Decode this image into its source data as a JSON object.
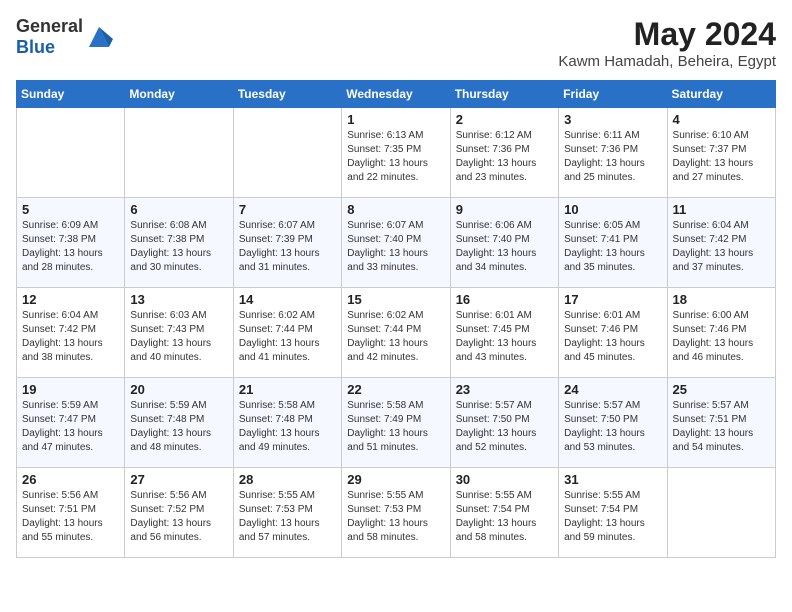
{
  "logo": {
    "general": "General",
    "blue": "Blue"
  },
  "title": "May 2024",
  "location": "Kawm Hamadah, Beheira, Egypt",
  "days_of_week": [
    "Sunday",
    "Monday",
    "Tuesday",
    "Wednesday",
    "Thursday",
    "Friday",
    "Saturday"
  ],
  "weeks": [
    [
      {
        "day": "",
        "sunrise": "",
        "sunset": "",
        "daylight": ""
      },
      {
        "day": "",
        "sunrise": "",
        "sunset": "",
        "daylight": ""
      },
      {
        "day": "",
        "sunrise": "",
        "sunset": "",
        "daylight": ""
      },
      {
        "day": "1",
        "sunrise": "Sunrise: 6:13 AM",
        "sunset": "Sunset: 7:35 PM",
        "daylight": "Daylight: 13 hours and 22 minutes."
      },
      {
        "day": "2",
        "sunrise": "Sunrise: 6:12 AM",
        "sunset": "Sunset: 7:36 PM",
        "daylight": "Daylight: 13 hours and 23 minutes."
      },
      {
        "day": "3",
        "sunrise": "Sunrise: 6:11 AM",
        "sunset": "Sunset: 7:36 PM",
        "daylight": "Daylight: 13 hours and 25 minutes."
      },
      {
        "day": "4",
        "sunrise": "Sunrise: 6:10 AM",
        "sunset": "Sunset: 7:37 PM",
        "daylight": "Daylight: 13 hours and 27 minutes."
      }
    ],
    [
      {
        "day": "5",
        "sunrise": "Sunrise: 6:09 AM",
        "sunset": "Sunset: 7:38 PM",
        "daylight": "Daylight: 13 hours and 28 minutes."
      },
      {
        "day": "6",
        "sunrise": "Sunrise: 6:08 AM",
        "sunset": "Sunset: 7:38 PM",
        "daylight": "Daylight: 13 hours and 30 minutes."
      },
      {
        "day": "7",
        "sunrise": "Sunrise: 6:07 AM",
        "sunset": "Sunset: 7:39 PM",
        "daylight": "Daylight: 13 hours and 31 minutes."
      },
      {
        "day": "8",
        "sunrise": "Sunrise: 6:07 AM",
        "sunset": "Sunset: 7:40 PM",
        "daylight": "Daylight: 13 hours and 33 minutes."
      },
      {
        "day": "9",
        "sunrise": "Sunrise: 6:06 AM",
        "sunset": "Sunset: 7:40 PM",
        "daylight": "Daylight: 13 hours and 34 minutes."
      },
      {
        "day": "10",
        "sunrise": "Sunrise: 6:05 AM",
        "sunset": "Sunset: 7:41 PM",
        "daylight": "Daylight: 13 hours and 35 minutes."
      },
      {
        "day": "11",
        "sunrise": "Sunrise: 6:04 AM",
        "sunset": "Sunset: 7:42 PM",
        "daylight": "Daylight: 13 hours and 37 minutes."
      }
    ],
    [
      {
        "day": "12",
        "sunrise": "Sunrise: 6:04 AM",
        "sunset": "Sunset: 7:42 PM",
        "daylight": "Daylight: 13 hours and 38 minutes."
      },
      {
        "day": "13",
        "sunrise": "Sunrise: 6:03 AM",
        "sunset": "Sunset: 7:43 PM",
        "daylight": "Daylight: 13 hours and 40 minutes."
      },
      {
        "day": "14",
        "sunrise": "Sunrise: 6:02 AM",
        "sunset": "Sunset: 7:44 PM",
        "daylight": "Daylight: 13 hours and 41 minutes."
      },
      {
        "day": "15",
        "sunrise": "Sunrise: 6:02 AM",
        "sunset": "Sunset: 7:44 PM",
        "daylight": "Daylight: 13 hours and 42 minutes."
      },
      {
        "day": "16",
        "sunrise": "Sunrise: 6:01 AM",
        "sunset": "Sunset: 7:45 PM",
        "daylight": "Daylight: 13 hours and 43 minutes."
      },
      {
        "day": "17",
        "sunrise": "Sunrise: 6:01 AM",
        "sunset": "Sunset: 7:46 PM",
        "daylight": "Daylight: 13 hours and 45 minutes."
      },
      {
        "day": "18",
        "sunrise": "Sunrise: 6:00 AM",
        "sunset": "Sunset: 7:46 PM",
        "daylight": "Daylight: 13 hours and 46 minutes."
      }
    ],
    [
      {
        "day": "19",
        "sunrise": "Sunrise: 5:59 AM",
        "sunset": "Sunset: 7:47 PM",
        "daylight": "Daylight: 13 hours and 47 minutes."
      },
      {
        "day": "20",
        "sunrise": "Sunrise: 5:59 AM",
        "sunset": "Sunset: 7:48 PM",
        "daylight": "Daylight: 13 hours and 48 minutes."
      },
      {
        "day": "21",
        "sunrise": "Sunrise: 5:58 AM",
        "sunset": "Sunset: 7:48 PM",
        "daylight": "Daylight: 13 hours and 49 minutes."
      },
      {
        "day": "22",
        "sunrise": "Sunrise: 5:58 AM",
        "sunset": "Sunset: 7:49 PM",
        "daylight": "Daylight: 13 hours and 51 minutes."
      },
      {
        "day": "23",
        "sunrise": "Sunrise: 5:57 AM",
        "sunset": "Sunset: 7:50 PM",
        "daylight": "Daylight: 13 hours and 52 minutes."
      },
      {
        "day": "24",
        "sunrise": "Sunrise: 5:57 AM",
        "sunset": "Sunset: 7:50 PM",
        "daylight": "Daylight: 13 hours and 53 minutes."
      },
      {
        "day": "25",
        "sunrise": "Sunrise: 5:57 AM",
        "sunset": "Sunset: 7:51 PM",
        "daylight": "Daylight: 13 hours and 54 minutes."
      }
    ],
    [
      {
        "day": "26",
        "sunrise": "Sunrise: 5:56 AM",
        "sunset": "Sunset: 7:51 PM",
        "daylight": "Daylight: 13 hours and 55 minutes."
      },
      {
        "day": "27",
        "sunrise": "Sunrise: 5:56 AM",
        "sunset": "Sunset: 7:52 PM",
        "daylight": "Daylight: 13 hours and 56 minutes."
      },
      {
        "day": "28",
        "sunrise": "Sunrise: 5:55 AM",
        "sunset": "Sunset: 7:53 PM",
        "daylight": "Daylight: 13 hours and 57 minutes."
      },
      {
        "day": "29",
        "sunrise": "Sunrise: 5:55 AM",
        "sunset": "Sunset: 7:53 PM",
        "daylight": "Daylight: 13 hours and 58 minutes."
      },
      {
        "day": "30",
        "sunrise": "Sunrise: 5:55 AM",
        "sunset": "Sunset: 7:54 PM",
        "daylight": "Daylight: 13 hours and 58 minutes."
      },
      {
        "day": "31",
        "sunrise": "Sunrise: 5:55 AM",
        "sunset": "Sunset: 7:54 PM",
        "daylight": "Daylight: 13 hours and 59 minutes."
      },
      {
        "day": "",
        "sunrise": "",
        "sunset": "",
        "daylight": ""
      }
    ]
  ]
}
